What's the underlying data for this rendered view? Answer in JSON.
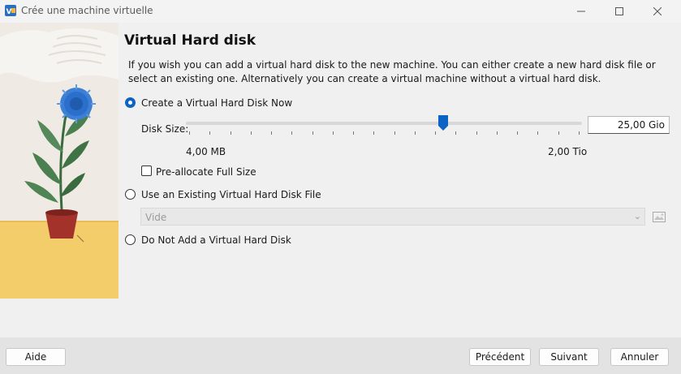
{
  "window": {
    "title": "Crée une machine virtuelle",
    "controls": [
      "minimize-icon",
      "maximize-icon",
      "close-icon"
    ]
  },
  "page": {
    "heading": "Virtual Hard disk",
    "description": "If you wish you can add a virtual hard disk to the new machine. You can either create a new hard disk file or select an existing one. Alternatively you can create a virtual machine without a virtual hard disk."
  },
  "options": {
    "create_now": {
      "label": "Create a Virtual Hard Disk Now",
      "checked": true
    },
    "disk_size": {
      "label": "Disk Size:",
      "value": "25,00 Gio",
      "min_label": "4,00 MB",
      "max_label": "2,00 Tio",
      "slider_fraction": 0.65
    },
    "preallocate": {
      "label": "Pre-allocate Full Size",
      "checked": false
    },
    "use_existing": {
      "label": "Use an Existing Virtual Hard Disk File",
      "checked": false
    },
    "existing_combo": {
      "value": "Vide",
      "enabled": false
    },
    "no_disk": {
      "label": "Do Not Add a Virtual Hard Disk",
      "checked": false
    }
  },
  "footer": {
    "help": "Aide",
    "back": "Précédent",
    "next": "Suivant",
    "cancel": "Annuler"
  },
  "colors": {
    "accent": "#0b63c5",
    "illustration_bg": "#f1ece4",
    "illustration_floor": "#f3cd6a"
  }
}
